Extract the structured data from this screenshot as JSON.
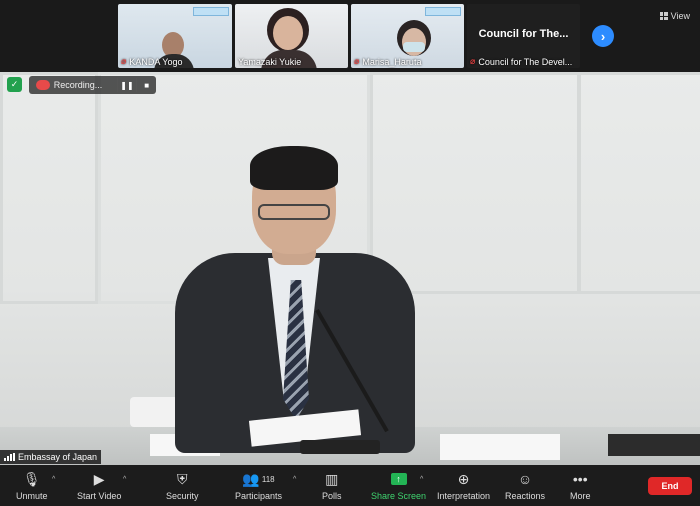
{
  "participants": [
    {
      "name": "KANDA Yogo",
      "muted": true
    },
    {
      "name": "Yamazaki Yukie",
      "muted": false
    },
    {
      "name": "Marisa_Haruta",
      "muted": true
    },
    {
      "name": "Council for The Devel...",
      "muted": true,
      "title": "Council for The..."
    }
  ],
  "view_label": "View",
  "recording": {
    "label": "Recording...",
    "pause_icon": "pause-icon",
    "stop_icon": "stop-icon"
  },
  "active_speaker": "Embassay of Japan",
  "toolbar": {
    "unmute": "Unmute",
    "start_video": "Start Video",
    "security": "Security",
    "participants": "Participants",
    "participants_count": "118",
    "polls": "Polls",
    "share_screen": "Share Screen",
    "interpretation": "Interpretation",
    "reactions": "Reactions",
    "more": "More",
    "end": "End"
  },
  "colors": {
    "accent": "#2d8cff",
    "share": "#23b455",
    "end": "#e02828",
    "muted": "#e04141"
  }
}
